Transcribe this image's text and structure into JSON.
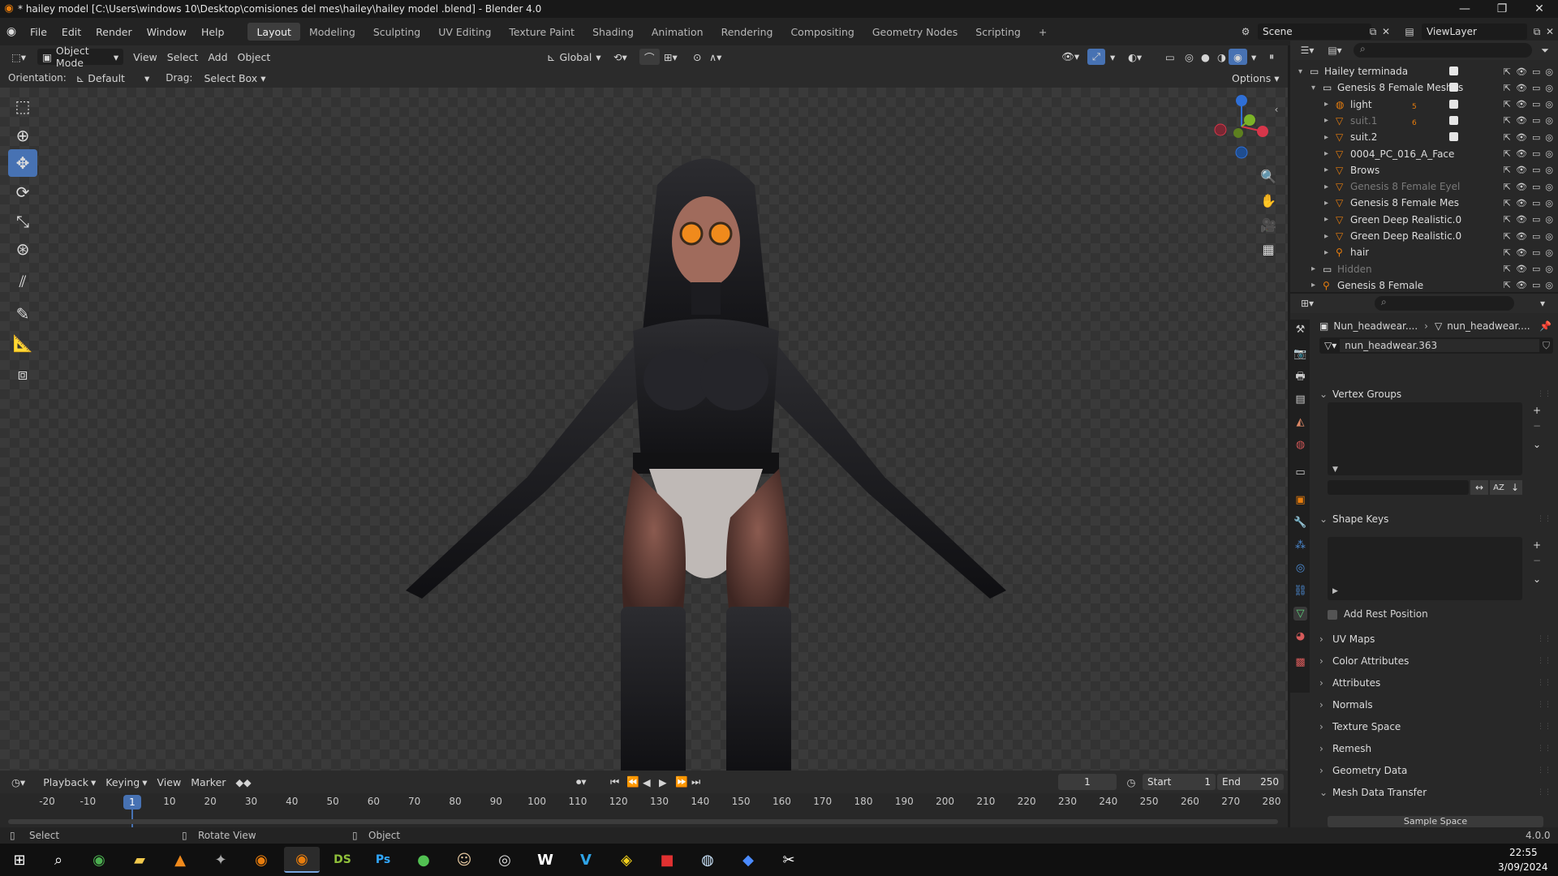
{
  "window": {
    "title": "* hailey model  [C:\\Users\\windows 10\\Desktop\\comisiones del mes\\hailey\\hailey model .blend] - Blender 4.0"
  },
  "menus": [
    "File",
    "Edit",
    "Render",
    "Window",
    "Help"
  ],
  "workspaces": [
    "Layout",
    "Modeling",
    "Sculpting",
    "UV Editing",
    "Texture Paint",
    "Shading",
    "Animation",
    "Rendering",
    "Compositing",
    "Geometry Nodes",
    "Scripting"
  ],
  "active_workspace": "Layout",
  "scene": {
    "scene_name": "Scene",
    "view_layer": "ViewLayer"
  },
  "viewport_header": {
    "mode": "Object Mode",
    "menu": [
      "View",
      "Select",
      "Add",
      "Object"
    ],
    "transform_orientation": "Global",
    "options": "Options"
  },
  "tool_settings": {
    "orientation_label": "Orientation:",
    "orientation_value": "Default",
    "drag_label": "Drag:",
    "drag_value": "Select Box"
  },
  "outliner": {
    "rows": [
      {
        "name": "Hailey terminada",
        "type": "collection",
        "indent": 0
      },
      {
        "name": "Genesis 8 Female Meshes",
        "type": "collection",
        "indent": 1
      },
      {
        "name": "light",
        "type": "object",
        "indent": 2,
        "badge": "5"
      },
      {
        "name": "suit.1",
        "type": "mesh",
        "indent": 2,
        "badge": "6",
        "dim": true
      },
      {
        "name": "suit.2",
        "type": "mesh",
        "indent": 2
      },
      {
        "name": "0004_PC_016_A_Face",
        "type": "mesh",
        "indent": 2
      },
      {
        "name": "Brows",
        "type": "mesh",
        "indent": 2
      },
      {
        "name": "Genesis 8 Female Eyel",
        "type": "mesh",
        "indent": 2,
        "dim": true
      },
      {
        "name": "Genesis 8 Female Mes",
        "type": "mesh",
        "indent": 2
      },
      {
        "name": "Green Deep Realistic.0",
        "type": "mesh",
        "indent": 2
      },
      {
        "name": "Green Deep Realistic.0",
        "type": "mesh",
        "indent": 2
      },
      {
        "name": "hair",
        "type": "armature",
        "indent": 2
      },
      {
        "name": "Hidden",
        "type": "collection",
        "indent": 1,
        "dim": true
      },
      {
        "name": "Genesis 8 Female",
        "type": "armature",
        "indent": 1
      }
    ]
  },
  "properties": {
    "breadcrumb": [
      "Nun_headwear....",
      "nun_headwear...."
    ],
    "mesh_name": "nun_headwear.363",
    "sections": [
      {
        "label": "Vertex Groups",
        "open": true
      },
      {
        "label": "Shape Keys",
        "open": true
      },
      {
        "label": "UV Maps",
        "open": false
      },
      {
        "label": "Color Attributes",
        "open": false
      },
      {
        "label": "Attributes",
        "open": false
      },
      {
        "label": "Normals",
        "open": false
      },
      {
        "label": "Texture Space",
        "open": false
      },
      {
        "label": "Remesh",
        "open": false
      },
      {
        "label": "Geometry Data",
        "open": false
      },
      {
        "label": "Mesh Data Transfer",
        "open": true
      }
    ],
    "add_rest_position": "Add Rest Position",
    "sample_space": "Sample Space"
  },
  "timeline": {
    "menus": [
      "Playback",
      "Keying",
      "View",
      "Marker"
    ],
    "current_frame": "1",
    "start_label": "Start",
    "start": "1",
    "end_label": "End",
    "end": "250",
    "ticks": [
      "-20",
      "-10",
      "0",
      "10",
      "20",
      "30",
      "40",
      "50",
      "60",
      "70",
      "80",
      "90",
      "100",
      "110",
      "120",
      "130",
      "140",
      "150",
      "160",
      "170",
      "180",
      "190",
      "200",
      "210",
      "220",
      "230",
      "240",
      "250",
      "260",
      "270",
      "280"
    ],
    "playhead_label": "1"
  },
  "statusbar": {
    "select": "Select",
    "rotate_view": "Rotate View",
    "object": "Object",
    "version": "4.0.0"
  },
  "taskbar": {
    "time": "22:55",
    "date": "3/09/2024",
    "apps": [
      "windows-start",
      "search",
      "chrome",
      "file-explorer",
      "vlc",
      "app-unknown",
      "blender",
      "blender-active",
      "daz-studio",
      "photoshop",
      "app-green",
      "app-character",
      "obs",
      "word",
      "vegas",
      "app-yellow",
      "app-red",
      "steam",
      "app-blue",
      "capcut"
    ]
  },
  "colors": {
    "accent_blue": "#4772b3",
    "blender_orange": "#e87d0d",
    "playhead": "#4772b3"
  }
}
